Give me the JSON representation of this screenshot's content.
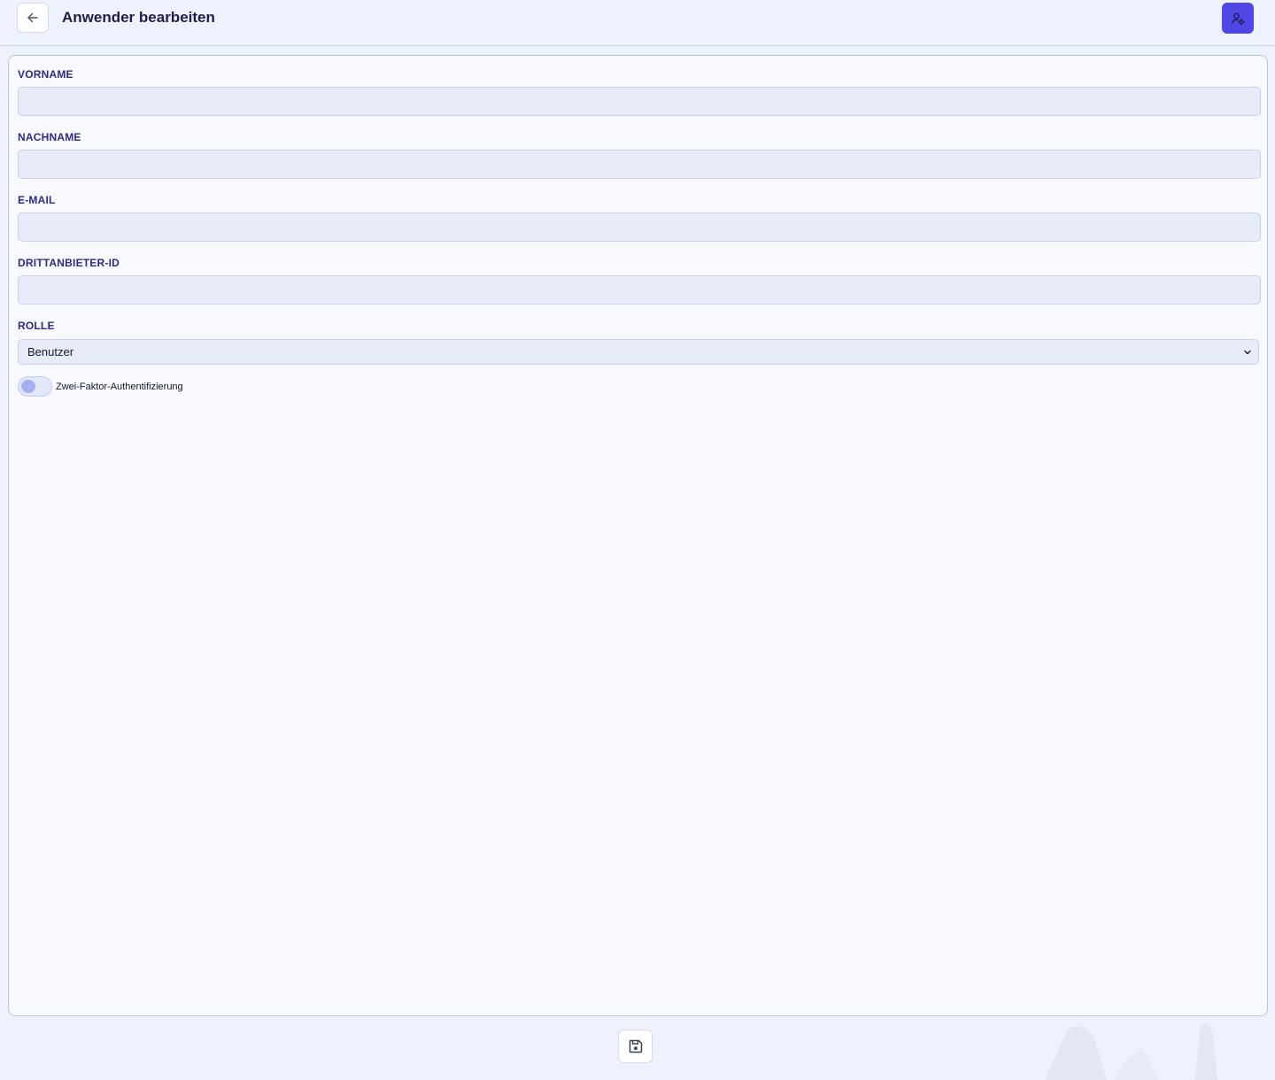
{
  "header": {
    "title": "Anwender bearbeiten",
    "back_icon": "arrow-left-icon",
    "settings_icon": "user-gear-icon",
    "accent_color": "#4f46e5"
  },
  "form": {
    "fields": [
      {
        "label": "VORNAME",
        "value": "",
        "placeholder": ""
      },
      {
        "label": "NACHNAME",
        "value": "",
        "placeholder": ""
      },
      {
        "label": "E-MAIL",
        "value": "",
        "placeholder": ""
      },
      {
        "label": "DRITTANBIETER-ID",
        "value": "",
        "placeholder": ""
      }
    ],
    "role": {
      "label": "ROLLE",
      "selected": "Benutzer",
      "chevron_icon": "chevron-down-icon"
    },
    "two_factor": {
      "label": "Zwei-Faktor-Authentifizierung",
      "enabled": false
    }
  },
  "footer": {
    "save_icon": "floppy-disk-icon"
  }
}
